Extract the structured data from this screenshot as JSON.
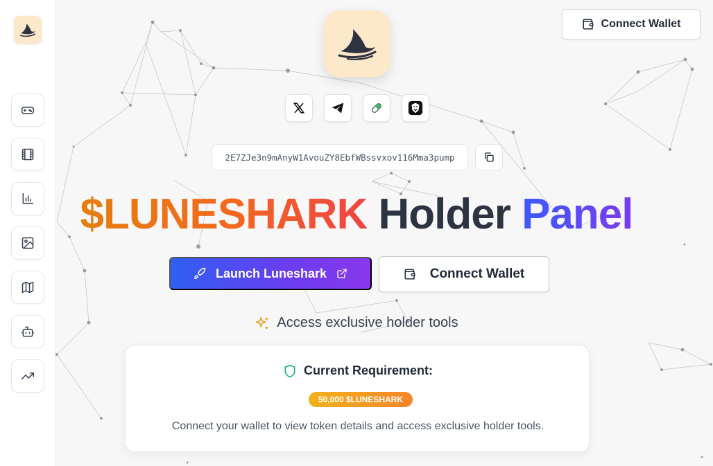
{
  "sidebar": {
    "items": [
      {
        "icon": "gamepad-icon"
      },
      {
        "icon": "film-icon"
      },
      {
        "icon": "bar-chart-icon"
      },
      {
        "icon": "image-icon"
      },
      {
        "icon": "map-icon"
      },
      {
        "icon": "bot-icon"
      },
      {
        "icon": "trending-up-icon"
      }
    ]
  },
  "header": {
    "connect_label": "Connect Wallet"
  },
  "socials": [
    {
      "icon": "x-twitter-icon"
    },
    {
      "icon": "telegram-icon"
    },
    {
      "icon": "pill-icon"
    },
    {
      "icon": "lion-icon"
    }
  ],
  "contract": {
    "address": "2E7ZJe3n9mAnyW1AvouZY8EbfWBssvxov116Mma3pump"
  },
  "hero": {
    "title_token": "$LUNESHARK",
    "title_holder": "Holder",
    "title_panel": "Panel",
    "launch_label": "Launch Luneshark",
    "connect_label": "Connect Wallet",
    "tagline": "Access exclusive holder tools"
  },
  "requirement": {
    "heading": "Current Requirement:",
    "badge": "50,000 $LUNESHARK",
    "description": "Connect your wallet to view token details and access exclusive holder tools."
  },
  "colors": {
    "accent_blue": "#2f5ff5",
    "accent_purple": "#8a37ec",
    "accent_orange": "#f26a1e",
    "logo_bg": "#fde9c9"
  }
}
